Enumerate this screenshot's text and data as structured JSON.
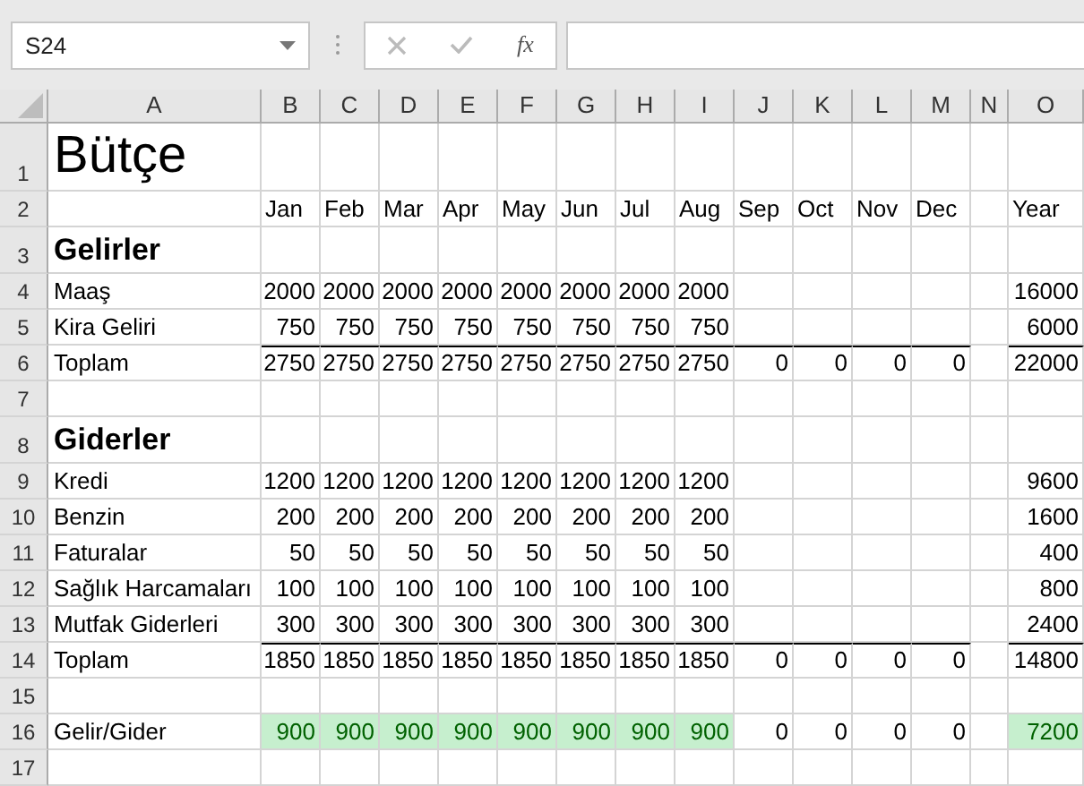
{
  "formula_bar": {
    "name_box": "S24",
    "function_label": "fx"
  },
  "columns": [
    "A",
    "B",
    "C",
    "D",
    "E",
    "F",
    "G",
    "H",
    "I",
    "J",
    "K",
    "L",
    "M",
    "N",
    "O"
  ],
  "rows": [
    {
      "header": "1",
      "kind": "title",
      "cells": [
        "Bütçe",
        null,
        null,
        null,
        null,
        null,
        null,
        null,
        null,
        null,
        null,
        null,
        null,
        null,
        null
      ]
    },
    {
      "header": "2",
      "kind": "months",
      "cells": [
        null,
        "Jan",
        "Feb",
        "Mar",
        "Apr",
        "May",
        "Jun",
        "Jul",
        "Aug",
        "Sep",
        "Oct",
        "Nov",
        "Dec",
        null,
        "Year"
      ]
    },
    {
      "header": "3",
      "kind": "heading",
      "cells": [
        "Gelirler",
        null,
        null,
        null,
        null,
        null,
        null,
        null,
        null,
        null,
        null,
        null,
        null,
        null,
        null
      ]
    },
    {
      "header": "4",
      "kind": "item",
      "cells": [
        "Maaş",
        "2000",
        "2000",
        "2000",
        "2000",
        "2000",
        "2000",
        "2000",
        "2000",
        null,
        null,
        null,
        null,
        null,
        "16000"
      ]
    },
    {
      "header": "5",
      "kind": "item",
      "cells": [
        "Kira Geliri",
        "750",
        "750",
        "750",
        "750",
        "750",
        "750",
        "750",
        "750",
        null,
        null,
        null,
        null,
        null,
        "6000"
      ]
    },
    {
      "header": "6",
      "kind": "total",
      "cells": [
        "Toplam",
        "2750",
        "2750",
        "2750",
        "2750",
        "2750",
        "2750",
        "2750",
        "2750",
        "0",
        "0",
        "0",
        "0",
        null,
        "22000"
      ]
    },
    {
      "header": "7",
      "kind": "blank",
      "cells": [
        null,
        null,
        null,
        null,
        null,
        null,
        null,
        null,
        null,
        null,
        null,
        null,
        null,
        null,
        null
      ]
    },
    {
      "header": "8",
      "kind": "heading",
      "cells": [
        "Giderler",
        null,
        null,
        null,
        null,
        null,
        null,
        null,
        null,
        null,
        null,
        null,
        null,
        null,
        null
      ]
    },
    {
      "header": "9",
      "kind": "item",
      "cells": [
        "Kredi",
        "1200",
        "1200",
        "1200",
        "1200",
        "1200",
        "1200",
        "1200",
        "1200",
        null,
        null,
        null,
        null,
        null,
        "9600"
      ]
    },
    {
      "header": "10",
      "kind": "item",
      "cells": [
        "Benzin",
        "200",
        "200",
        "200",
        "200",
        "200",
        "200",
        "200",
        "200",
        null,
        null,
        null,
        null,
        null,
        "1600"
      ]
    },
    {
      "header": "11",
      "kind": "item",
      "cells": [
        "Faturalar",
        "50",
        "50",
        "50",
        "50",
        "50",
        "50",
        "50",
        "50",
        null,
        null,
        null,
        null,
        null,
        "400"
      ]
    },
    {
      "header": "12",
      "kind": "item",
      "cells": [
        "Sağlık Harcamaları",
        "100",
        "100",
        "100",
        "100",
        "100",
        "100",
        "100",
        "100",
        null,
        null,
        null,
        null,
        null,
        "800"
      ]
    },
    {
      "header": "13",
      "kind": "item",
      "cells": [
        "Mutfak Giderleri",
        "300",
        "300",
        "300",
        "300",
        "300",
        "300",
        "300",
        "300",
        null,
        null,
        null,
        null,
        null,
        "2400"
      ]
    },
    {
      "header": "14",
      "kind": "total",
      "cells": [
        "Toplam",
        "1850",
        "1850",
        "1850",
        "1850",
        "1850",
        "1850",
        "1850",
        "1850",
        "0",
        "0",
        "0",
        "0",
        null,
        "14800"
      ]
    },
    {
      "header": "15",
      "kind": "blank",
      "cells": [
        null,
        null,
        null,
        null,
        null,
        null,
        null,
        null,
        null,
        null,
        null,
        null,
        null,
        null,
        null
      ]
    },
    {
      "header": "16",
      "kind": "item",
      "cells": [
        "Gelir/Gider",
        {
          "text": "900",
          "highlighted": true
        },
        {
          "text": "900",
          "highlighted": true
        },
        {
          "text": "900",
          "highlighted": true
        },
        {
          "text": "900",
          "highlighted": true
        },
        {
          "text": "900",
          "highlighted": true
        },
        {
          "text": "900",
          "highlighted": true
        },
        {
          "text": "900",
          "highlighted": true
        },
        {
          "text": "900",
          "highlighted": true
        },
        {
          "text": "0",
          "highlighted": false
        },
        {
          "text": "0",
          "highlighted": false
        },
        {
          "text": "0",
          "highlighted": false
        },
        {
          "text": "0",
          "highlighted": false
        },
        null,
        {
          "text": "7200",
          "highlighted": true
        }
      ]
    },
    {
      "header": "17",
      "kind": "blank",
      "cells": [
        null,
        null,
        null,
        null,
        null,
        null,
        null,
        null,
        null,
        null,
        null,
        null,
        null,
        null,
        null
      ]
    }
  ]
}
